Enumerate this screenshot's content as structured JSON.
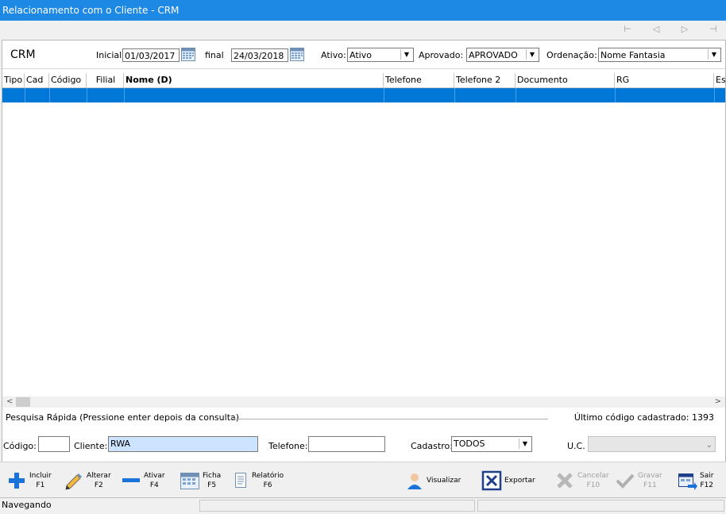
{
  "window": {
    "title": "Relacionamento com o Cliente - CRM"
  },
  "header": {
    "title": "CRM"
  },
  "filters": {
    "inicial_label": "Inicial",
    "inicial_value": "01/03/2017",
    "final_label": "final",
    "final_value": "24/03/2018",
    "ativo_label": "Ativo:",
    "ativo_value": "Ativo",
    "aprovado_label": "Aprovado:",
    "aprovado_value": "APROVADO",
    "ordenacao_label": "Ordenação:",
    "ordenacao_value": "Nome Fantasia"
  },
  "grid": {
    "columns": [
      "Tipo",
      "Cad",
      "Código",
      "Filial",
      "Nome (D)",
      "Telefone",
      "Telefone 2",
      "Documento",
      "RG",
      "Es"
    ]
  },
  "quick_search": {
    "title": "Pesquisa Rápida (Pressione enter depois da consulta)",
    "last_code": "Último código cadastrado: 1393",
    "codigo_label": "Código:",
    "codigo_value": "",
    "cliente_label": "Cliente:",
    "cliente_value": "RWA",
    "telefone_label": "Telefone:",
    "telefone_value": "",
    "cadastro_label": "Cadastro:",
    "cadastro_value": "TODOS",
    "uc_label": "U.C.",
    "uc_value": ""
  },
  "toolbar": {
    "incluir": "Incluir",
    "incluir_key": "F1",
    "alterar": "Alterar",
    "alterar_key": "F2",
    "ativar": "Ativar",
    "ativar_key": "F4",
    "ficha": "Ficha",
    "ficha_key": "F5",
    "relatorio": "Relatório",
    "relatorio_key": "F6",
    "visualizar": "Visualizar",
    "exportar": "Exportar",
    "cancelar": "Cancelar",
    "cancelar_key": "F10",
    "gravar": "Gravar",
    "gravar_key": "F11",
    "sair": "Sair",
    "sair_key": "F12"
  },
  "status": {
    "text": "Navegando"
  },
  "colors": {
    "titlebar": "#1e88e5",
    "selection": "#0078d7",
    "search_highlight": "#cce4ff"
  },
  "icons": [
    "calendar-icon",
    "plus-icon",
    "pencil-icon",
    "minus-icon",
    "grid-icon",
    "report-icon",
    "user-icon",
    "excel-icon",
    "x-icon",
    "check-icon",
    "exit-icon"
  ]
}
